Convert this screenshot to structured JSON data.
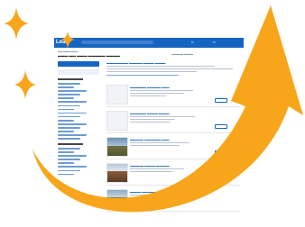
{
  "screenshot": {
    "logo": "Lead"
  },
  "colors": {
    "arrow": "#f7a61b",
    "sparkle": "#f7a61b",
    "topbar": "#1565c0"
  },
  "icons": [
    "sparkle-icon",
    "sparkle-icon",
    "sparkle-icon",
    "curved-arrow-icon"
  ]
}
